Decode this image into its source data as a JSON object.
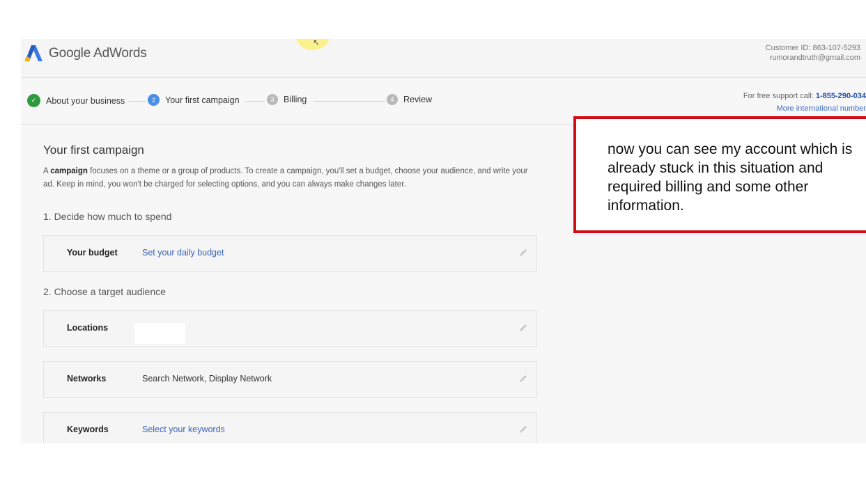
{
  "header": {
    "logo_text": "Google AdWords",
    "customer_id": "Customer ID: 863-107-5293",
    "email": "rumorandtruth@gmail.com",
    "cursor_glyph": "↖"
  },
  "stepper": {
    "steps": [
      {
        "label": "About your business",
        "state": "done",
        "marker": "✓"
      },
      {
        "label": "Your first campaign",
        "state": "active",
        "marker": "2"
      },
      {
        "label": "Billing",
        "state": "pending",
        "marker": "3"
      },
      {
        "label": "Review",
        "state": "pending",
        "marker": "4"
      }
    ],
    "support_prefix": "For free support call:",
    "support_phone": "1-855-290-034",
    "intl_link": "More international number"
  },
  "main": {
    "title": "Your first campaign",
    "intro_bold": "campaign",
    "intro_prefix": "A",
    "intro_rest": "focuses on a theme or a group of products. To create a campaign, you'll set a budget, choose your audience, and write your ad. Keep in mind, you won't be charged for selecting options, and you can always make changes later.",
    "section1": "1. Decide how much to spend",
    "section2": "2. Choose a target audience",
    "rows": {
      "budget": {
        "label": "Your budget",
        "value": "Set your daily budget"
      },
      "locations": {
        "label": "Locations",
        "value": ""
      },
      "networks": {
        "label": "Networks",
        "value": "Search Network, Display Network"
      },
      "keywords": {
        "label": "Keywords",
        "value": "Select your keywords"
      }
    }
  },
  "annotation": {
    "text": "now you can see my account which is already stuck in this situation and required billing and some other information."
  },
  "colors": {
    "brand_blue": "#4285f4",
    "step_done": "#2e9b3e",
    "step_active": "#4a8ee6",
    "link": "#3a63b8",
    "callout_border": "#d40b12"
  }
}
